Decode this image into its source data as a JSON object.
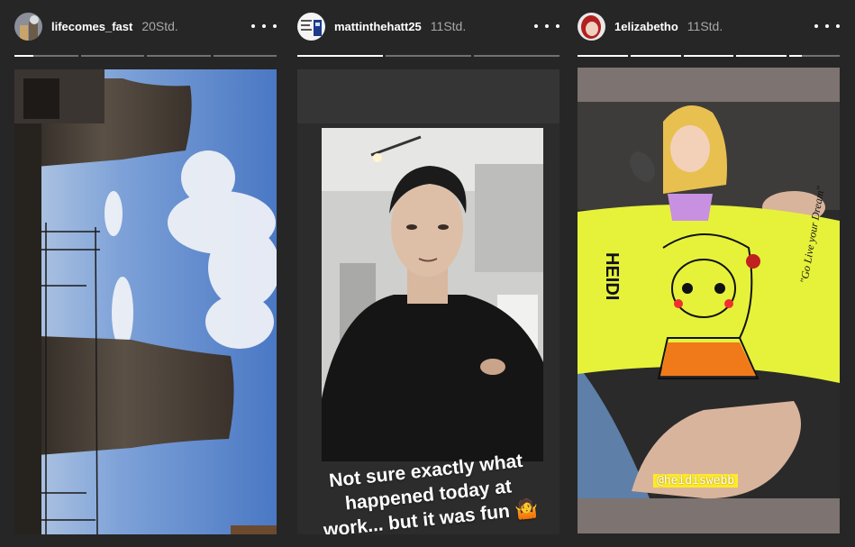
{
  "stories": [
    {
      "username": "lifecomes_fast",
      "time": "20Std.",
      "avatar_icon": "cooling-tower-avatar",
      "segments": 4,
      "progress": [
        0.3,
        0,
        0,
        0
      ]
    },
    {
      "username": "mattinthehatt25",
      "time": "11Std.",
      "avatar_icon": "police-box-avatar",
      "segments": 3,
      "progress": [
        1,
        0,
        0
      ],
      "caption_lines": [
        "Not sure exactly what",
        "happened today at",
        "work... but it was fun 🤷"
      ]
    },
    {
      "username": "1elizabetho",
      "time": "11Std.",
      "avatar_icon": "red-hair-avatar",
      "segments": 5,
      "progress": [
        1,
        1,
        1,
        1,
        0.25
      ],
      "mention": "@heidiswebb",
      "tape_name": "HEIDI",
      "tape_slogan": "\"Go Live your Dream\""
    }
  ],
  "colors": {
    "background": "#262626",
    "mention_bg": "#ffea2a",
    "tape_yellow": "#e6f23a"
  }
}
